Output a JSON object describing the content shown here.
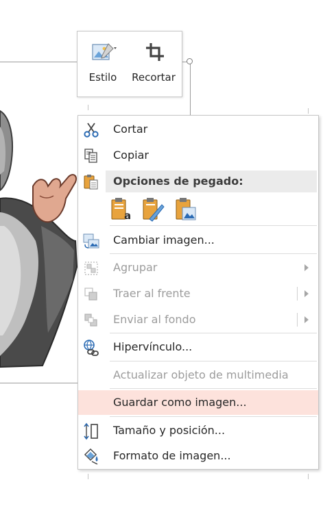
{
  "mini_toolbar": {
    "style_label": "Estilo",
    "crop_label": "Recortar"
  },
  "context_menu": {
    "cut": "Cortar",
    "copy": "Copiar",
    "paste_header": "Opciones de pegado:",
    "paste_options": [
      "keep-source-formatting-icon",
      "use-destination-theme-icon",
      "picture-paste-icon"
    ],
    "change_picture": "Cambiar imagen...",
    "group": "Agrupar",
    "bring_to_front": "Traer al frente",
    "send_to_back": "Enviar al fondo",
    "hyperlink": "Hipervínculo...",
    "update_media": "Actualizar objeto de multimedia",
    "save_as_picture": "Guardar como imagen...",
    "size_position": "Tamaño y posición...",
    "format_picture": "Formato de imagen..."
  },
  "colors": {
    "highlight": "#fde2dc",
    "icon_blue": "#2b6bb4",
    "icon_orange": "#e8a33d"
  }
}
